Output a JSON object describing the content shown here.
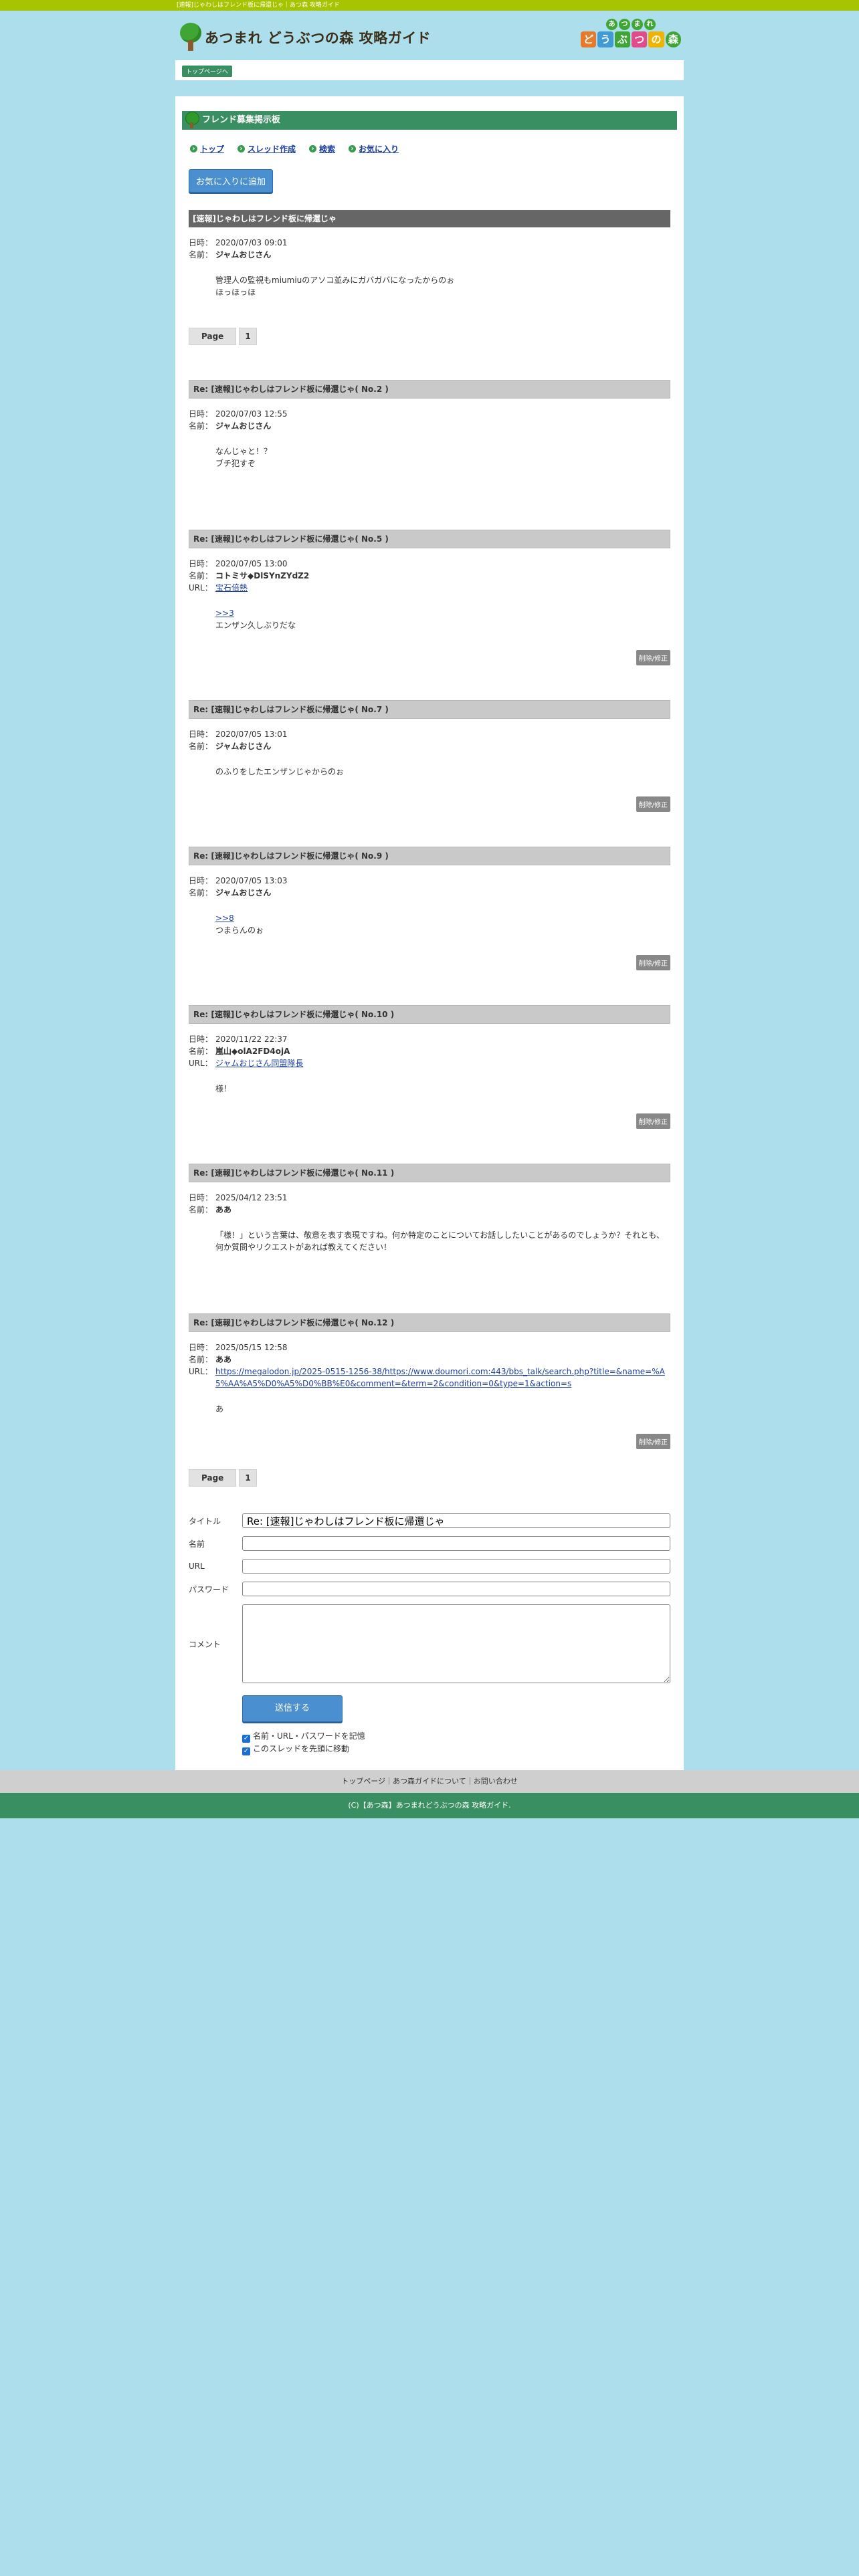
{
  "topbar": {
    "text": "[速報]じゃわしはフレンド板に帰還じゃ｜あつ森 攻略ガイド"
  },
  "header": {
    "logo_text": "あつまれ どうぶつの森 攻略ガイド",
    "badge_top": [
      "あ",
      "つ",
      "ま",
      "れ"
    ],
    "badge_bottom": [
      "ど",
      "う",
      "ぶ",
      "つ",
      "の",
      "森"
    ]
  },
  "breadcrumb": {
    "label": "トップページへ"
  },
  "board": {
    "title": "フレンド募集掲示板",
    "nav": [
      "トップ",
      "スレッド作成",
      "検索",
      "お気に入り"
    ],
    "fav_button": "お気に入りに追加"
  },
  "labels": {
    "date": "日時：",
    "name": "名前：",
    "url": "URL：",
    "delete": "削除/修正"
  },
  "thread": {
    "title": "[速報]じゃわしはフレンド板に帰還じゃ",
    "date": "2020/07/03 09:01",
    "name": "ジャムおじさん",
    "body": [
      "管理人の監視もmiumiuのアソコ並みにガバガバになったからのぉ",
      "ほっほっほ"
    ]
  },
  "pager": {
    "label": "Page",
    "page": "1"
  },
  "posts": [
    {
      "title": "Re: [速報]じゃわしはフレンド板に帰還じゃ( No.2 )",
      "date": "2020/07/03 12:55",
      "name": "ジャムおじさん",
      "url": "",
      "reply": "",
      "body": [
        "なんじゃと！？",
        "ブチ犯すぞ"
      ],
      "delete": false
    },
    {
      "title": "Re: [速報]じゃわしはフレンド板に帰還じゃ( No.5 )",
      "date": "2020/07/05 13:00",
      "name": "コトミサ◆DlSYnZYdZ2",
      "url": "宝石倍熱",
      "reply": ">>3",
      "body": [
        "エンザン久しぶりだな"
      ],
      "delete": true
    },
    {
      "title": "Re: [速報]じゃわしはフレンド板に帰還じゃ( No.7 )",
      "date": "2020/07/05 13:01",
      "name": "ジャムおじさん",
      "url": "",
      "reply": "",
      "body": [
        "のふりをしたエンザンじゃからのぉ"
      ],
      "delete": true
    },
    {
      "title": "Re: [速報]じゃわしはフレンド板に帰還じゃ( No.9 )",
      "date": "2020/07/05 13:03",
      "name": "ジャムおじさん",
      "url": "",
      "reply": ">>8",
      "body": [
        "つまらんのぉ"
      ],
      "delete": true
    },
    {
      "title": "Re: [速報]じゃわしはフレンド板に帰還じゃ( No.10 )",
      "date": "2020/11/22 22:37",
      "name": "嵐山◆olA2FD4ojA",
      "url": "ジャムおじさん同盟隊長",
      "reply": "",
      "body": [
        "様！"
      ],
      "delete": true
    },
    {
      "title": "Re: [速報]じゃわしはフレンド板に帰還じゃ( No.11 )",
      "date": "2025/04/12 23:51",
      "name": "ああ",
      "url": "",
      "reply": "",
      "body": [
        "「様！」という言葉は、敬意を表す表現ですね。何か特定のことについてお話ししたいことがあるのでしょうか？それとも、何か質問やリクエストがあれば教えてください！"
      ],
      "delete": false
    },
    {
      "title": "Re: [速報]じゃわしはフレンド板に帰還じゃ( No.12 )",
      "date": "2025/05/15 12:58",
      "name": "ああ",
      "url": "https://megalodon.jp/2025-0515-1256-38/https://www.doumori.com:443/bbs_talk/search.php?title=&name=%A5%AA%A5%D0%A5%D0%BB%E0&comment=&term=2&condition=0&type=1&action=s",
      "reply": "",
      "body": [
        "あ"
      ],
      "delete": true
    }
  ],
  "form": {
    "title_label": "タイトル",
    "title_value": "Re: [速報]じゃわしはフレンド板に帰還じゃ",
    "name_label": "名前",
    "url_label": "URL",
    "password_label": "パスワード",
    "comment_label": "コメント",
    "submit": "送信する",
    "check1": "名前・URL・パスワードを記憶",
    "check2": "このスレッドを先頭に移動"
  },
  "footer": {
    "nav": "トップページ｜あつ森ガイドについて｜お問い合わせ",
    "copyright": "(C)【あつ森】あつまれどうぶつの森 攻略ガイド."
  },
  "colors": {
    "accent_green": "#3a8f62",
    "top_lime": "#a7c400",
    "bg_blue": "#acdeeb",
    "button_blue": "#4a90d0"
  }
}
